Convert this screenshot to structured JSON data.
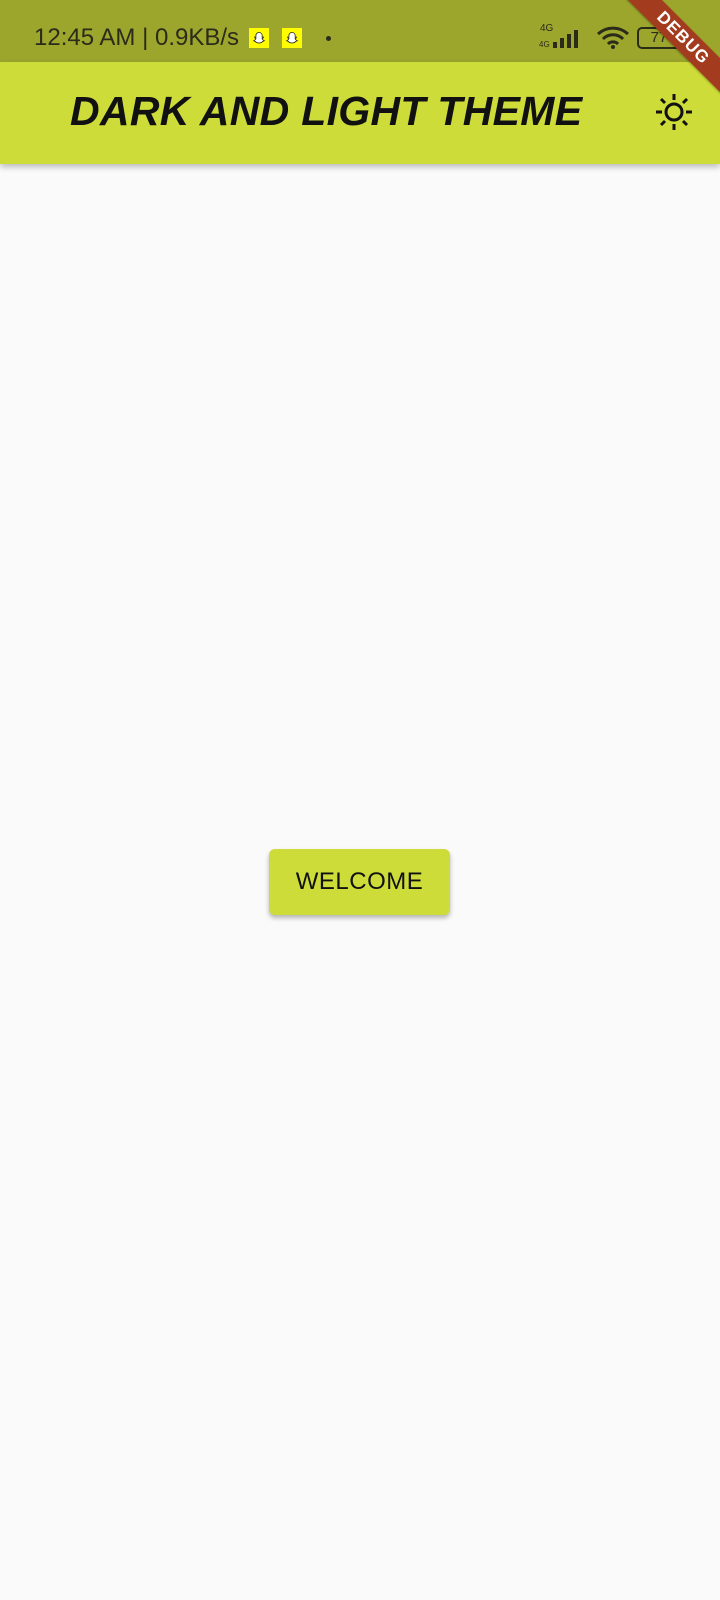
{
  "status_bar": {
    "time_speed": "12:45 AM | 0.9KB/s",
    "network_type": "4G",
    "network_sub": "4G",
    "battery": "77",
    "notification_icons": [
      "snapchat-icon",
      "snapchat-icon",
      "dot-icon"
    ]
  },
  "app_bar": {
    "title": "DARK AND LIGHT THEME",
    "action_icon": "sun-icon"
  },
  "debug_banner": "DEBUG",
  "main": {
    "welcome_button_label": "WELCOME"
  },
  "colors": {
    "status_bar": "#9ca62d",
    "app_bar": "#cddc39",
    "button": "#cddc39",
    "background": "#fafafa",
    "debug_banner": "#a33c1e"
  }
}
